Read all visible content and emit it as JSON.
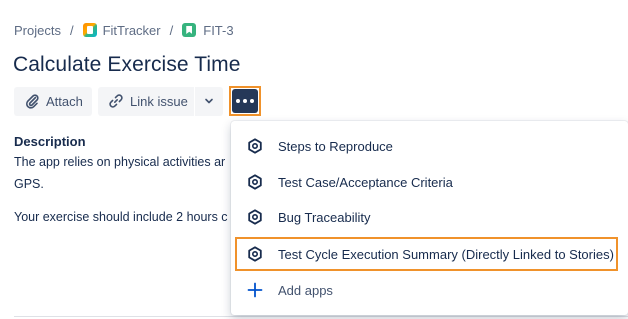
{
  "breadcrumb": {
    "projects": "Projects",
    "separator": "/",
    "project": "FitTracker",
    "issue_key": "FIT-3"
  },
  "issue": {
    "title": "Calculate Exercise Time"
  },
  "toolbar": {
    "attach_label": "Attach",
    "link_label": "Link issue"
  },
  "description": {
    "label": "Description",
    "line1": "The app relies on physical activities ar",
    "line1_end": "ı",
    "line2": "GPS.",
    "line3": "Your exercise should include 2 hours c",
    "line3_end": "n"
  },
  "more_menu": {
    "items": [
      {
        "label": "Steps to Reproduce",
        "icon": "hexagon-app-icon"
      },
      {
        "label": "Test Case/Acceptance Criteria",
        "icon": "hexagon-app-icon"
      },
      {
        "label": "Bug Traceability",
        "icon": "hexagon-app-icon"
      },
      {
        "label": "Test Cycle Execution Summary (Directly Linked to Stories)",
        "icon": "hexagon-app-icon",
        "highlighted": true
      },
      {
        "label": "Add apps",
        "icon": "plus-icon"
      }
    ]
  },
  "colors": {
    "highlight": "#f0922b",
    "more_button": "#253858",
    "add_icon": "#0052cc"
  }
}
